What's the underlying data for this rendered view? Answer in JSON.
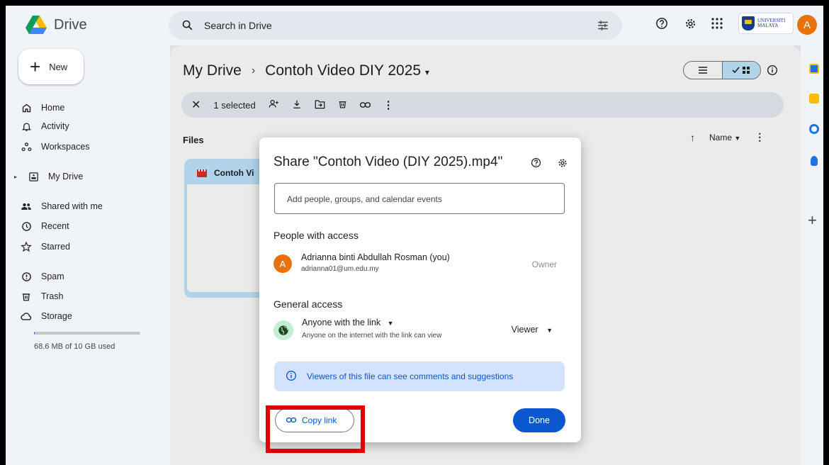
{
  "app": {
    "name": "Drive"
  },
  "search": {
    "placeholder": "Search in Drive"
  },
  "org": {
    "name_line1": "UNIVERSITI",
    "name_line2": "MALAYA"
  },
  "user": {
    "initial": "A"
  },
  "sidebar": {
    "new_label": "New",
    "items": [
      {
        "label": "Home",
        "icon": "home-icon"
      },
      {
        "label": "Activity",
        "icon": "bell-icon"
      },
      {
        "label": "Workspaces",
        "icon": "workspaces-icon"
      },
      {
        "label": "My Drive",
        "icon": "my-drive-icon"
      },
      {
        "label": "Shared with me",
        "icon": "people-icon"
      },
      {
        "label": "Recent",
        "icon": "clock-icon"
      },
      {
        "label": "Starred",
        "icon": "star-icon"
      },
      {
        "label": "Spam",
        "icon": "spam-icon"
      },
      {
        "label": "Trash",
        "icon": "trash-icon"
      },
      {
        "label": "Storage",
        "icon": "cloud-icon"
      }
    ],
    "storage_text": "68.6 MB of 10 GB used",
    "storage_fraction": 0.0067
  },
  "main": {
    "breadcrumb_root": "My Drive",
    "breadcrumb_separator": "›",
    "breadcrumb_current": "Contoh Video DIY 2025",
    "selection_text": "1 selected",
    "files_label": "Files",
    "sort_label": "Name",
    "file_card_name": "Contoh Vi"
  },
  "dialog": {
    "title": "Share \"Contoh Video (DIY 2025).mp4\"",
    "add_placeholder": "Add people, groups, and calendar events",
    "people_heading": "People with access",
    "person": {
      "initial": "A",
      "name": "Adrianna binti Abdullah Rosman (you)",
      "email": "adrianna01@um.edu.my",
      "role": "Owner"
    },
    "general_heading": "General access",
    "access_type": "Anyone with the link",
    "access_desc": "Anyone on the internet with the link can view",
    "access_role": "Viewer",
    "info_banner": "Viewers of this file can see comments and suggestions",
    "copy_link_label": "Copy link",
    "done_label": "Done"
  },
  "colors": {
    "accent": "#0b57d0",
    "highlight": "#e00000",
    "avatar": "#e8710a"
  }
}
